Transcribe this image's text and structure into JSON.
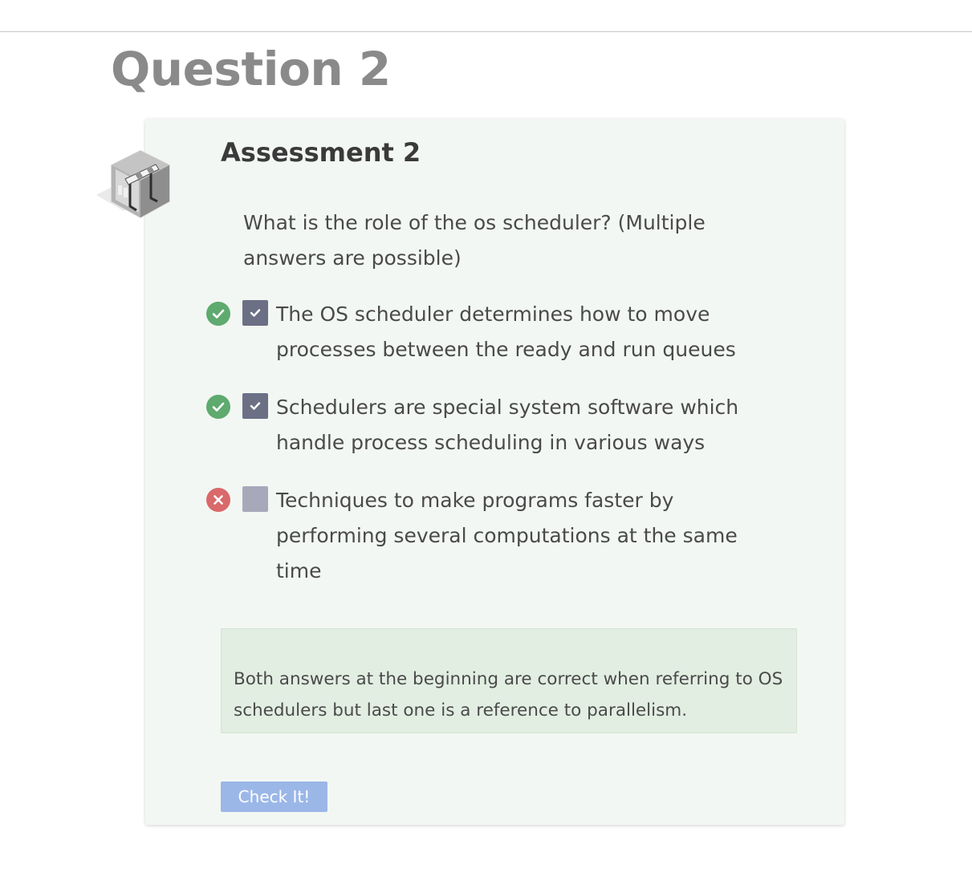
{
  "page": {
    "title": "Question 2"
  },
  "assessment": {
    "title": "Assessment 2",
    "badge_icon": "assessment-hurdle-icon",
    "question": "What is the role of the os scheduler? (Multiple answers are possible)",
    "options": [
      {
        "text": "The OS scheduler determines how to move processes between the ready and run queues",
        "checked": true,
        "status": "correct",
        "status_icon": "check-circle-icon"
      },
      {
        "text": "Schedulers are special system software which handle process scheduling in various ways",
        "checked": true,
        "status": "correct",
        "status_icon": "check-circle-icon"
      },
      {
        "text": "Techniques to make programs faster by performing several computations at the same time",
        "checked": false,
        "status": "incorrect",
        "status_icon": "x-circle-icon"
      }
    ],
    "feedback": "Both answers at the beginning are correct when referring to OS schedulers but last one is a reference to parallelism.",
    "check_button_label": "Check It!"
  },
  "colors": {
    "correct": "#5eaa6f",
    "incorrect": "#d9696b",
    "checkbox_checked": "#6c7085",
    "checkbox_unchecked": "#a7a9bb",
    "button": "#9bb7e8",
    "card_background": "#f3f7f3",
    "feedback_background": "#e2eee2"
  }
}
